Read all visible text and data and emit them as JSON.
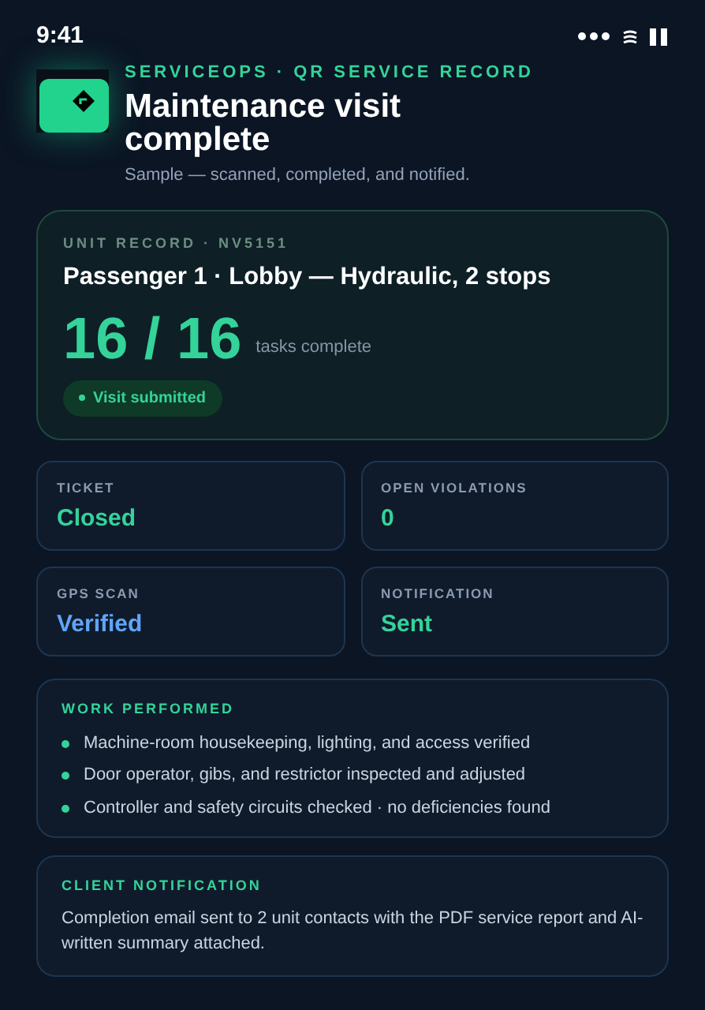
{
  "status_bar": {
    "time": "9:41"
  },
  "header": {
    "eyebrow": "SERVICEOPS · QR SERVICE RECORD",
    "title": "Maintenance visit complete",
    "subtitle": "Sample — scanned, completed, and notified."
  },
  "unit_card": {
    "label": "UNIT RECORD · NV5151",
    "title": "Passenger 1 · Lobby — Hydraulic, 2 stops",
    "count": "16 / 16",
    "count_caption": "tasks complete",
    "badge": "Visit submitted"
  },
  "stats": [
    {
      "label": "TICKET",
      "value": "Closed",
      "color": "#34d399"
    },
    {
      "label": "OPEN VIOLATIONS",
      "value": "0",
      "color": "#34d399"
    },
    {
      "label": "GPS SCAN",
      "value": "Verified",
      "color": "#60a5fa"
    },
    {
      "label": "NOTIFICATION",
      "value": "Sent",
      "color": "#34d399"
    }
  ],
  "work_performed": {
    "title": "WORK PERFORMED",
    "items": [
      "Machine-room housekeeping, lighting, and access verified",
      "Door operator, gibs, and restrictor inspected and adjusted",
      "Controller and safety circuits checked · no deficiencies found"
    ]
  },
  "client_notification": {
    "title": "CLIENT NOTIFICATION",
    "text": "Completion email sent to 2 unit contacts with the PDF service report and AI-written summary attached."
  }
}
